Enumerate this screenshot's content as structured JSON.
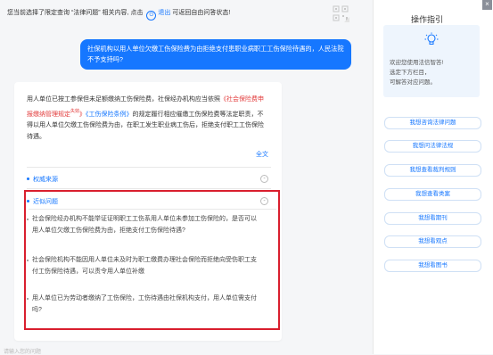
{
  "notice": {
    "prefix": "您当前选择了限定查询 “法律问题” 相关内容, 点击",
    "exit_label": "退出",
    "suffix": "可返回自由问答状态!"
  },
  "user_message": "社保机构以用人单位欠缴工伤保险费为由拒绝支付患职业病职工工伤保险待遇的，人民法院不予支持吗?",
  "answer": {
    "text_1": "用人单位已按工参保但未足额缴纳工伤保险费，社保经办机构应当依照",
    "link_red": "《社会保险费申报缴纳管理规定",
    "sup": "失效",
    "text_2": "》",
    "link_blue": "《工伤保险条例》",
    "text_3": "的规定履行相应催缴工伤保险费等法定职责，不得以用人单位欠缴工伤保险费为由，在职工发生职业病工伤后，拒绝支付职工工伤保险待遇。",
    "full_text_label": "全文"
  },
  "sections": {
    "authority": "权威来源",
    "related": "近似问题"
  },
  "related_questions": [
    "社会保险经办机构不能举证证明职工工伤系用人单位未参加工伤保险的，是否可以用人单位欠缴工伤保险费为由，拒绝支付工伤保险待遇?",
    "社会保险机构不能因用人单位未及时为职工缴费办理社会保险而拒绝向受伤职工支付工伤保险待遇，可以责令用人单位补缴",
    "用人单位已为劳动者缴纳了工伤保险，工伤待遇由社保机构支付，用人单位需支付吗?"
  ],
  "footer_hint": "请输入您的问题",
  "sidebar": {
    "title": "操作指引",
    "close": "×",
    "guide_lines": [
      "欢迎您使用法信智答!",
      "选定下方栏目，",
      "可解答对应问题。"
    ],
    "buttons": [
      "我想咨询法律问题",
      "我想问法律法规",
      "我想查看裁判规则",
      "我想查看类案",
      "我想看期刊",
      "我想看观点",
      "我想看图书"
    ]
  },
  "colors": {
    "accent": "#1677ff",
    "highlight_border": "#d91f2e",
    "red_link": "#e23a3a"
  }
}
